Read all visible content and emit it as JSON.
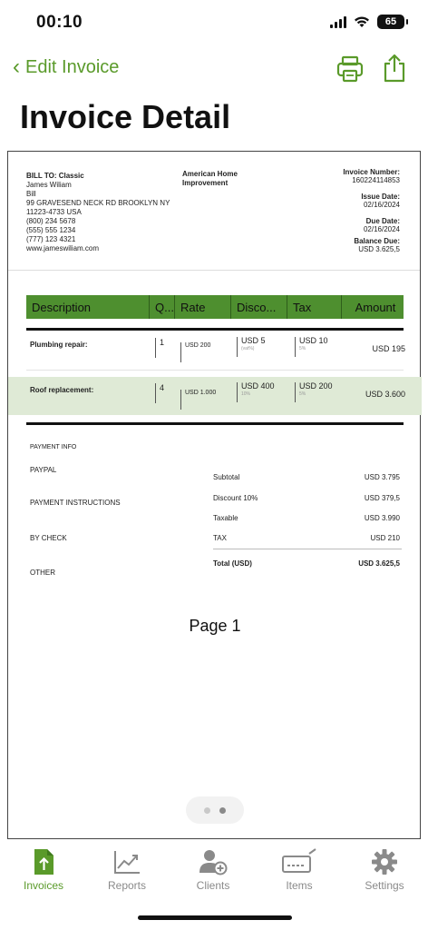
{
  "status": {
    "time": "00:10",
    "battery": "65"
  },
  "nav": {
    "back_label": "Edit Invoice",
    "title": "Invoice Detail"
  },
  "colors": {
    "accent": "#5a9a2a",
    "header_green": "#4e8f2f",
    "row_highlight": "#dfead6"
  },
  "invoice": {
    "bill_to": {
      "label": "BILL TO: Classic",
      "name": "James Wiliam",
      "first_name": "Bill",
      "address1": "99 GRAVESEND NECK RD BROOKLYN NY",
      "address2": "11223-4733 USA",
      "phone1": "(800) 234 5678",
      "phone2": "(555) 555 1234",
      "phone3": "(777) 123 4321",
      "website": "www.jameswiliam.com"
    },
    "company": "American Home Improvement",
    "meta": {
      "number_label": "Invoice Number:",
      "number": "160224114853",
      "issue_label": "Issue Date:",
      "issue_date": "02/16/2024",
      "due_label": "Due Date:",
      "due_date": "02/16/2024",
      "balance_label": "Balance Due:",
      "balance": "USD 3.625,5"
    },
    "columns": [
      "Description",
      "Q...",
      "Rate",
      "Disco...",
      "Tax",
      "Amount"
    ],
    "items": [
      {
        "description": "Plumbing repair:",
        "qty": "1",
        "rate": "USD 200",
        "discount": "USD 5",
        "discount_sub": "(vat%)",
        "tax": "USD 10",
        "tax_sub": "5%",
        "amount": "USD 195"
      },
      {
        "description": "Roof replacement:",
        "qty": "4",
        "rate": "USD 1.000",
        "discount": "USD 400",
        "discount_sub": "10%",
        "tax": "USD 200",
        "tax_sub": "5%",
        "amount": "USD 3.600"
      }
    ],
    "payment": {
      "heading": "PAYMENT INFO",
      "paypal": "PAYPAL",
      "instructions": "PAYMENT INSTRUCTIONS",
      "check": "BY CHECK",
      "other": "OTHER"
    },
    "totals": {
      "subtotal_label": "Subtotal",
      "subtotal": "USD 3.795",
      "discount_label": "Discount 10%",
      "discount": "USD 379,5",
      "taxable_label": "Taxable",
      "taxable": "USD 3.990",
      "tax_label": "TAX",
      "tax": "USD 210",
      "total_label": "Total (USD)",
      "total": "USD 3.625,5"
    },
    "page": "Page 1"
  },
  "tabs": [
    {
      "label": "Invoices",
      "icon": "invoice-icon",
      "active": true
    },
    {
      "label": "Reports",
      "icon": "chart-icon",
      "active": false
    },
    {
      "label": "Clients",
      "icon": "client-add-icon",
      "active": false
    },
    {
      "label": "Items",
      "icon": "items-icon",
      "active": false
    },
    {
      "label": "Settings",
      "icon": "gear-icon",
      "active": false
    }
  ]
}
